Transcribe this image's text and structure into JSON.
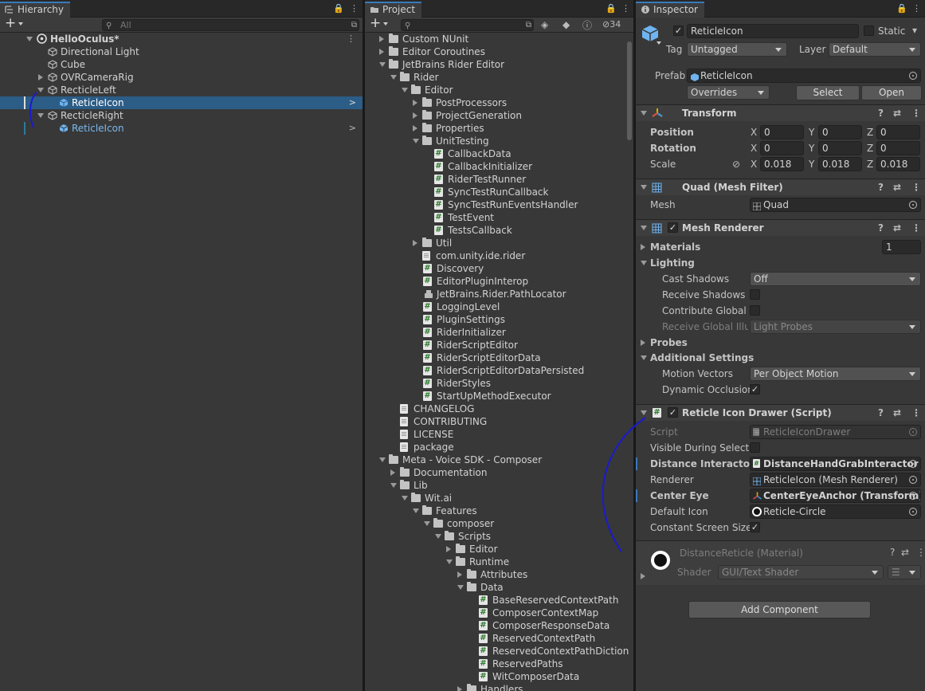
{
  "hierarchy": {
    "tab_label": "Hierarchy",
    "search_placeholder": "All",
    "scene_name": "HelloOculus*",
    "items": [
      {
        "label": "Directional Light"
      },
      {
        "label": "Cube"
      },
      {
        "label": "OVRCameraRig"
      },
      {
        "label": "RecticleLeft"
      },
      {
        "label": "ReticleIcon"
      },
      {
        "label": "RecticleRight"
      },
      {
        "label": "ReticleIcon"
      }
    ]
  },
  "project": {
    "tab_label": "Project",
    "hidden_count": "34",
    "items": [
      {
        "label": "Custom NUnit"
      },
      {
        "label": "Editor Coroutines"
      },
      {
        "label": "JetBrains Rider Editor"
      },
      {
        "label": "Rider"
      },
      {
        "label": "Editor"
      },
      {
        "label": "PostProcessors"
      },
      {
        "label": "ProjectGeneration"
      },
      {
        "label": "Properties"
      },
      {
        "label": "UnitTesting"
      },
      {
        "label": "CallbackData"
      },
      {
        "label": "CallbackInitializer"
      },
      {
        "label": "RiderTestRunner"
      },
      {
        "label": "SyncTestRunCallback"
      },
      {
        "label": "SyncTestRunEventsHandler"
      },
      {
        "label": "TestEvent"
      },
      {
        "label": "TestsCallback"
      },
      {
        "label": "Util"
      },
      {
        "label": "com.unity.ide.rider"
      },
      {
        "label": "Discovery"
      },
      {
        "label": "EditorPluginInterop"
      },
      {
        "label": "JetBrains.Rider.PathLocator"
      },
      {
        "label": "LoggingLevel"
      },
      {
        "label": "PluginSettings"
      },
      {
        "label": "RiderInitializer"
      },
      {
        "label": "RiderScriptEditor"
      },
      {
        "label": "RiderScriptEditorData"
      },
      {
        "label": "RiderScriptEditorDataPersisted"
      },
      {
        "label": "RiderStyles"
      },
      {
        "label": "StartUpMethodExecutor"
      },
      {
        "label": "CHANGELOG"
      },
      {
        "label": "CONTRIBUTING"
      },
      {
        "label": "LICENSE"
      },
      {
        "label": "package"
      },
      {
        "label": "Meta - Voice SDK - Composer"
      },
      {
        "label": "Documentation"
      },
      {
        "label": "Lib"
      },
      {
        "label": "Wit.ai"
      },
      {
        "label": "Features"
      },
      {
        "label": "composer"
      },
      {
        "label": "Scripts"
      },
      {
        "label": "Editor"
      },
      {
        "label": "Runtime"
      },
      {
        "label": "Attributes"
      },
      {
        "label": "Data"
      },
      {
        "label": "BaseReservedContextPath"
      },
      {
        "label": "ComposerContextMap"
      },
      {
        "label": "ComposerResponseData"
      },
      {
        "label": "ReservedContextPath"
      },
      {
        "label": "ReservedContextPathDiction"
      },
      {
        "label": "ReservedPaths"
      },
      {
        "label": "WitComposerData"
      },
      {
        "label": "Handlers"
      }
    ]
  },
  "inspector": {
    "tab_label": "Inspector",
    "object_name": "ReticleIcon",
    "static_label": "Static",
    "tag_label": "Tag",
    "tag_value": "Untagged",
    "layer_label": "Layer",
    "layer_value": "Default",
    "prefab_label": "Prefab",
    "prefab_value": "ReticleIcon",
    "overrides_label": "Overrides",
    "select_label": "Select",
    "open_label": "Open",
    "transform": {
      "title": "Transform",
      "position_label": "Position",
      "rotation_label": "Rotation",
      "scale_label": "Scale",
      "x": "X",
      "y": "Y",
      "z": "Z",
      "position": [
        "0",
        "0",
        "0"
      ],
      "rotation": [
        "0",
        "0",
        "0"
      ],
      "scale": [
        "0.018",
        "0.018",
        "0.018"
      ]
    },
    "mesh_filter": {
      "title": "Quad (Mesh Filter)",
      "mesh_label": "Mesh",
      "mesh_value": "Quad"
    },
    "mesh_renderer": {
      "title": "Mesh Renderer",
      "materials_label": "Materials",
      "materials_value": "1",
      "lighting_label": "Lighting",
      "cast_shadows_label": "Cast Shadows",
      "cast_shadows_value": "Off",
      "receive_shadows_label": "Receive Shadows",
      "contribute_gi_label": "Contribute Global Il",
      "receive_gi_label": "Receive Global Illur",
      "receive_gi_value": "Light Probes",
      "probes_label": "Probes",
      "additional_label": "Additional Settings",
      "motion_vectors_label": "Motion Vectors",
      "motion_vectors_value": "Per Object Motion",
      "dynamic_occlusion_label": "Dynamic Occlusion"
    },
    "script": {
      "title": "Reticle Icon Drawer (Script)",
      "script_label": "Script",
      "script_value": "ReticleIconDrawer",
      "visible_label": "Visible During Select",
      "distance_label": "Distance Interactor",
      "distance_value": "DistanceHandGrabInteractor (I",
      "renderer_label": "Renderer",
      "renderer_value": "ReticleIcon (Mesh Renderer)",
      "center_eye_label": "Center Eye",
      "center_eye_value": "CenterEyeAnchor (Transform)",
      "default_icon_label": "Default Icon",
      "default_icon_value": "Reticle-Circle",
      "constant_label": "Constant Screen Size"
    },
    "material": {
      "name": "DistanceReticle (Material)",
      "shader_label": "Shader",
      "shader_value": "GUI/Text Shader"
    },
    "add_component_label": "Add Component"
  },
  "colors": {
    "selection": "#2c5d87",
    "accent": "#3a79bb",
    "annotation": "#1a1ad0"
  }
}
